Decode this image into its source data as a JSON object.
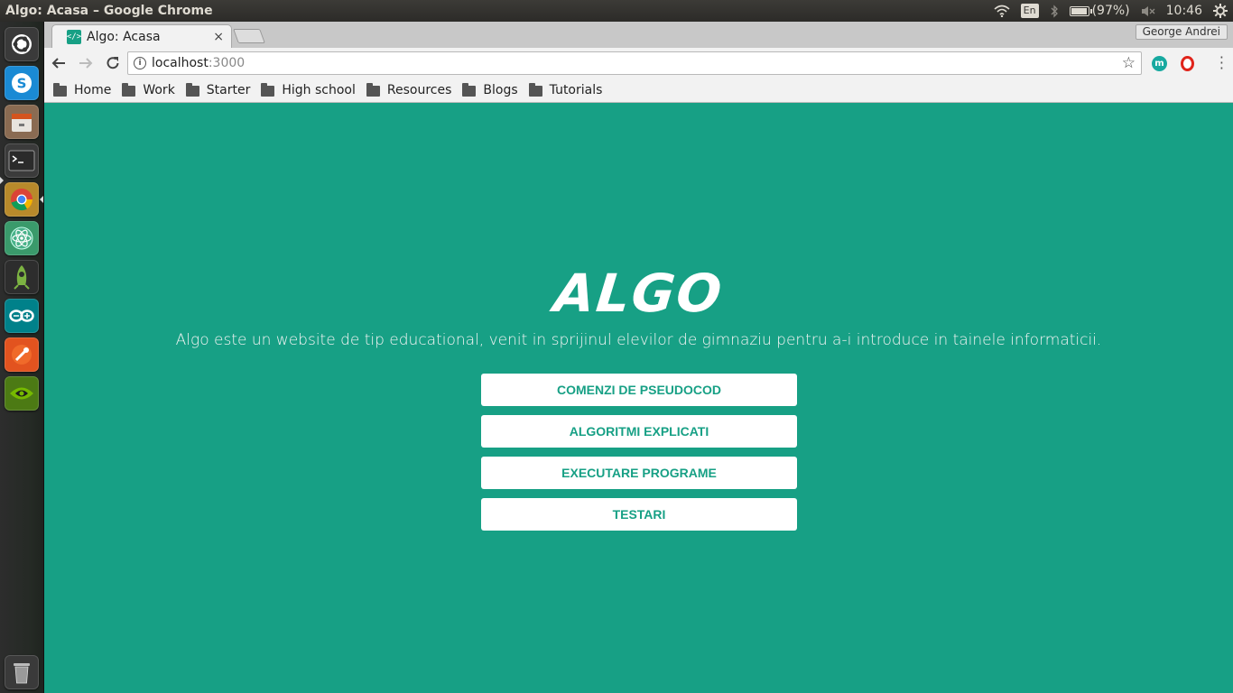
{
  "top_panel": {
    "window_title": "Algo: Acasa – Google Chrome",
    "keyboard_layout": "En",
    "battery": "(97%)",
    "battery_level": 0.97,
    "clock": "10:46"
  },
  "launcher": {
    "items": [
      "ubuntu-dash",
      "skype",
      "files",
      "terminal",
      "chrome",
      "atom",
      "android-studio",
      "arduino",
      "postman",
      "nvidia-settings"
    ],
    "trash": "trash"
  },
  "browser": {
    "tab_title": "Algo: Acasa",
    "tab_close": "×",
    "profile_name": "George Andrei",
    "url_host": "localhost",
    "url_port": ":3000",
    "bookmarks": [
      "Home",
      "Work",
      "Starter",
      "High school",
      "Resources",
      "Blogs",
      "Tutorials"
    ]
  },
  "page": {
    "logo": "ALGO",
    "tagline": "Algo este un website de tip educational, venit in sprijinul elevilor de gimnaziu pentru a-i introduce in tainele informaticii.",
    "buttons": [
      "COMENZI DE PSEUDOCOD",
      "ALGORITMI EXPLICATI",
      "EXECUTARE PROGRAME",
      "TESTARI"
    ]
  },
  "colors": {
    "accent": "#17a085",
    "button_bg": "#ffffff"
  }
}
